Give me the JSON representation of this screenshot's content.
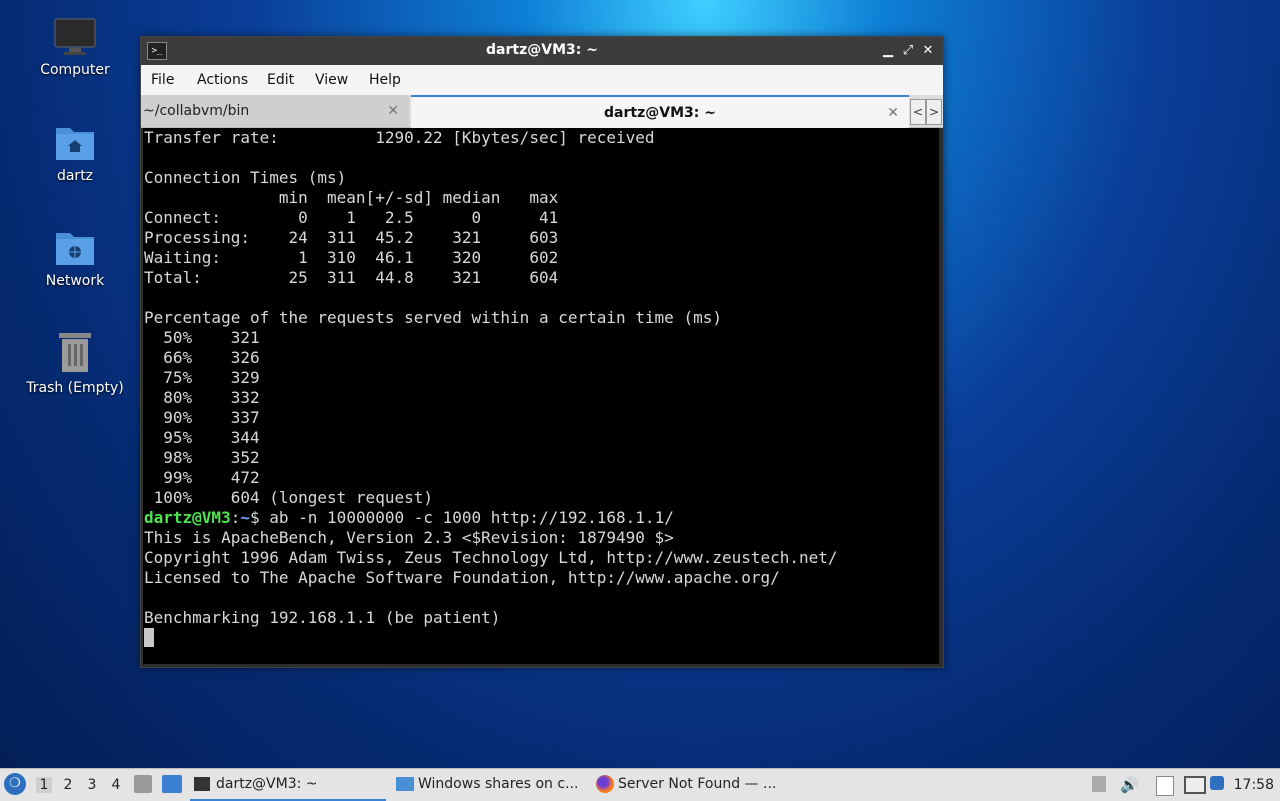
{
  "desktop": {
    "icons": [
      {
        "label": "Computer",
        "icon": "monitor-icon"
      },
      {
        "label": "dartz",
        "icon": "home-folder-icon"
      },
      {
        "label": "Network",
        "icon": "network-folder-icon"
      },
      {
        "label": "Trash (Empty)",
        "icon": "trash-icon"
      }
    ]
  },
  "window": {
    "title": "dartz@VM3: ~",
    "menu": [
      "File",
      "Actions",
      "Edit",
      "View",
      "Help"
    ],
    "tabs": [
      {
        "label": "~/collabvm/bin",
        "active": false
      },
      {
        "label": "dartz@VM3: ~",
        "active": true
      }
    ],
    "close_glyph": "✕",
    "tab_close_glyph": "✕",
    "scroll_left": "<",
    "scroll_right": ">"
  },
  "terminal": {
    "lines": [
      "Transfer rate:          1290.22 [Kbytes/sec] received",
      "",
      "Connection Times (ms)",
      "              min  mean[+/-sd] median   max",
      "Connect:        0    1   2.5      0      41",
      "Processing:    24  311  45.2    321     603",
      "Waiting:        1  310  46.1    320     602",
      "Total:         25  311  44.8    321     604",
      "",
      "Percentage of the requests served within a certain time (ms)",
      "  50%    321",
      "  66%    326",
      "  75%    329",
      "  80%    332",
      "  90%    337",
      "  95%    344",
      "  98%    352",
      "  99%    472",
      " 100%    604 (longest request)"
    ],
    "prompt_user": "dartz@VM3",
    "prompt_sep": ":",
    "prompt_path": "~",
    "prompt_dollar": "$ ",
    "command": "ab -n 10000000 -c 1000 http://192.168.1.1/",
    "after_lines": [
      "This is ApacheBench, Version 2.3 <$Revision: 1879490 $>",
      "Copyright 1996 Adam Twiss, Zeus Technology Ltd, http://www.zeustech.net/",
      "Licensed to The Apache Software Foundation, http://www.apache.org/",
      "",
      "Benchmarking 192.168.1.1 (be patient)"
    ]
  },
  "taskbar": {
    "workspaces": [
      "1",
      "2",
      "3",
      "4"
    ],
    "active_workspace": "1",
    "tasks": [
      {
        "label": "dartz@VM3: ~",
        "icon": "terminal-icon",
        "active": true
      },
      {
        "label": "Windows shares on c...",
        "icon": "folder-icon",
        "active": false
      },
      {
        "label": "Server Not Found — ...",
        "icon": "firefox-icon",
        "active": false
      }
    ],
    "clock": "17:58"
  },
  "colors": {
    "accent": "#3b82d6",
    "prompt_user": "#4ee54e",
    "prompt_path": "#6aa2ff",
    "terminal_bg": "#000000"
  }
}
